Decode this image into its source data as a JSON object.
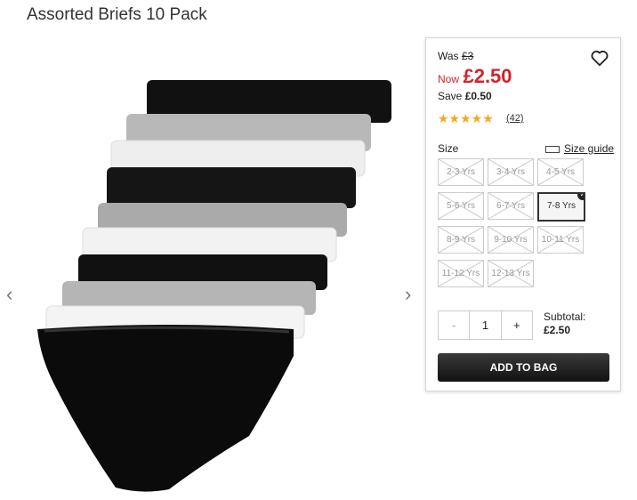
{
  "product": {
    "title": "Assorted Briefs 10 Pack"
  },
  "price": {
    "was_label": "Was",
    "was_value": "£3",
    "now_label": "Now",
    "now_value": "£2.50",
    "save_label": "Save",
    "save_value": "£0.50"
  },
  "rating": {
    "stars": "★★★★★",
    "reviews": "(42)"
  },
  "size": {
    "label": "Size",
    "guide_label": "Size guide",
    "options": [
      "2-3 Yrs",
      "3-4 Yrs",
      "4-5 Yrs",
      "5-6 Yrs",
      "6-7 Yrs",
      "7-8 Yrs",
      "8-9 Yrs",
      "9-10 Yrs",
      "10-11 Yrs",
      "11-12 Yrs",
      "12-13 Yrs"
    ],
    "selected": "7-8 Yrs"
  },
  "quantity": {
    "minus": "-",
    "value": "1",
    "plus": "+"
  },
  "subtotal": {
    "label": "Subtotal:",
    "value": "£2.50"
  },
  "actions": {
    "add_to_bag": "ADD TO BAG"
  },
  "icons": {
    "prev": "chevron-left-icon",
    "next": "chevron-right-icon",
    "wishlist": "heart-icon",
    "size_guide": "ruler-icon"
  },
  "colors": {
    "sale_red": "#d2232a",
    "star": "#f5a623"
  }
}
